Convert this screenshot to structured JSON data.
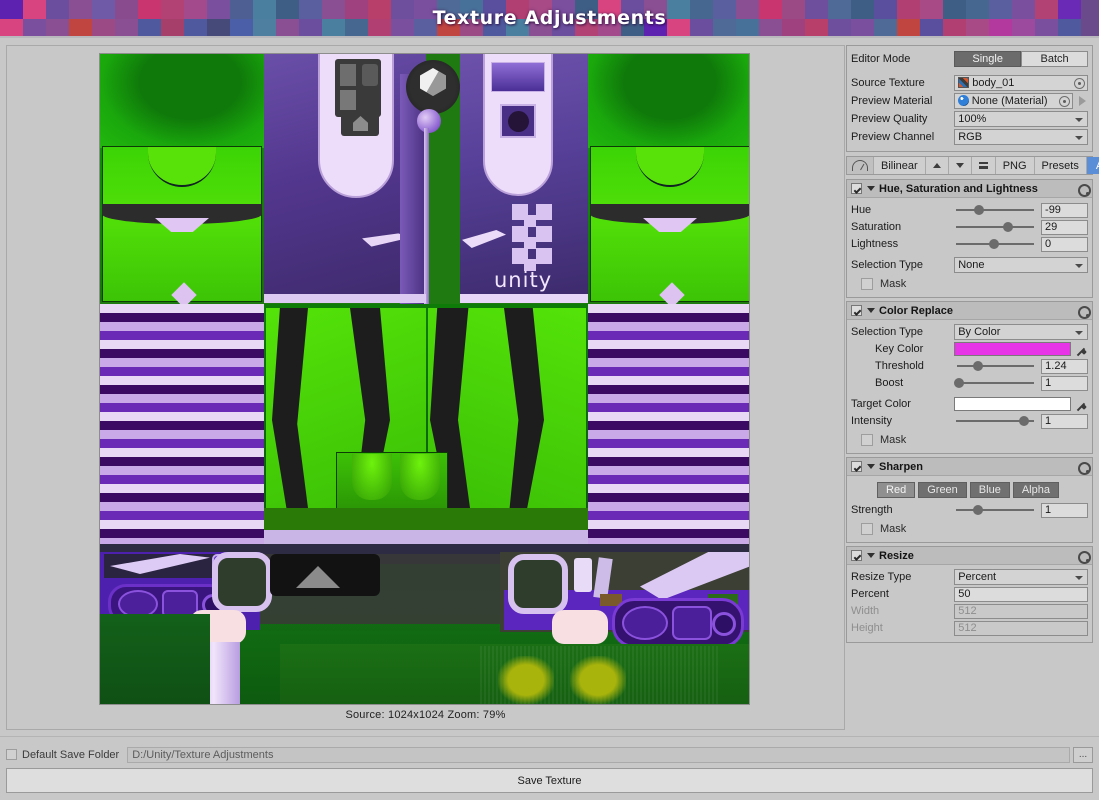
{
  "window": {
    "title": "Texture Adjustments"
  },
  "titlebar_tiles": [
    "#5e22b0",
    "#d8447f",
    "#6b4f9e",
    "#8a4f92",
    "#6f5aa8",
    "#8a4b8e",
    "#c9356f",
    "#b14273",
    "#a24a8c",
    "#7a4f9e",
    "#4e5f94",
    "#4a7fa0",
    "#3f5e86",
    "#5a5fa0",
    "#8a4f92",
    "#a0417f",
    "#b73f6a",
    "#6d4f9e",
    "#7a4f9e",
    "#4f6a96",
    "#48719a",
    "#5a4f9e",
    "#b23f72",
    "#a74a86",
    "#7b4f9e",
    "#3f5e86",
    "#d8447f",
    "#6b4f9e",
    "#8a4f92",
    "#4a7fa0",
    "#46678f",
    "#5a5fa0",
    "#8a4f92",
    "#c9356f",
    "#9b4a86",
    "#6d4f9e",
    "#4f6a96",
    "#3f5e86",
    "#5a4f9e",
    "#b23f72",
    "#a74a86",
    "#3f5e86",
    "#46678f",
    "#5a5fa0",
    "#7a4f9e",
    "#b14273",
    "#6b2ab5",
    "#d8447f",
    "#7a4f9e",
    "#8a4f92",
    "#c0443f",
    "#9b4a86",
    "#8a4f92",
    "#4f5a9e",
    "#a63f6a",
    "#4f5a9e",
    "#454a78",
    "#4a5fa8",
    "#4f7fa0",
    "#8a4f92",
    "#6b4f9e",
    "#4a7fa0",
    "#46678f",
    "#b23f72",
    "#7a4f9e",
    "#5a5fa0",
    "#c0443f",
    "#9b4a86",
    "#4f5a9e",
    "#4a7fa0",
    "#8a4f92",
    "#6b4f9e",
    "#b14273",
    "#a24a8c",
    "#3f5e86",
    "#5e22b0",
    "#d8447f",
    "#6b4f9e",
    "#4f6a96",
    "#48719a",
    "#8a4f92",
    "#a0417f",
    "#b73f6a",
    "#6d4f9e",
    "#7a4f9e",
    "#4f6a96",
    "#c0443f",
    "#5a4f9e",
    "#b23f72",
    "#a74a86",
    "#b4399e",
    "#9b4a9e",
    "#7a4f9e",
    "#4f5a9e",
    "#4a7fa0",
    "#c0443f",
    "#a74a86",
    "#8a4f92",
    "#3f6fa0",
    "#5a5fa0"
  ],
  "preview": {
    "status": "Source: 1024x1024   Zoom: 79%",
    "source_size": "1024x1024",
    "zoom": "79%"
  },
  "inspector": {
    "editor_mode": {
      "label": "Editor Mode",
      "options": [
        "Single",
        "Batch"
      ],
      "selected": "Single"
    },
    "source_texture": {
      "label": "Source Texture",
      "value": "body_01",
      "icon": "texture-icon"
    },
    "preview_material": {
      "label": "Preview Material",
      "value": "None (Material)",
      "icon": "material-icon"
    },
    "preview_quality": {
      "label": "Preview Quality",
      "value": "100%"
    },
    "preview_channel": {
      "label": "Preview Channel",
      "value": "RGB"
    },
    "toolbar": {
      "gauge_icon": "gauge-icon",
      "filter_mode": "Bilinear",
      "move_up_icon": "arrow-up-icon",
      "move_down_icon": "arrow-down-icon",
      "menu_icon": "hamburger-icon",
      "format": "PNG",
      "presets": "Presets",
      "add": "Add"
    },
    "modules": [
      {
        "name": "hsl",
        "title": "Hue, Saturation and Lightness",
        "enabled": true,
        "sliders": [
          {
            "label": "Hue",
            "value": "-99",
            "pos": 28
          },
          {
            "label": "Saturation",
            "value": "29",
            "pos": 62
          },
          {
            "label": "Lightness",
            "value": "0",
            "pos": 45
          }
        ],
        "selection_type": {
          "label": "Selection Type",
          "value": "None"
        },
        "mask": {
          "label": "Mask",
          "checked": false
        }
      },
      {
        "name": "color-replace",
        "title": "Color Replace",
        "enabled": true,
        "selection_type": {
          "label": "Selection Type",
          "value": "By Color"
        },
        "key_color": {
          "label": "Key Color",
          "color": "#e634e6"
        },
        "threshold": {
          "label": "Threshold",
          "value": "1.24",
          "pos": 25
        },
        "boost": {
          "label": "Boost",
          "value": "1",
          "pos": 3
        },
        "target_color": {
          "label": "Target Color",
          "color": "#ffffff"
        },
        "intensity": {
          "label": "Intensity",
          "value": "1",
          "pos": 85
        },
        "mask": {
          "label": "Mask",
          "checked": false
        }
      },
      {
        "name": "sharpen",
        "title": "Sharpen",
        "enabled": true,
        "channels": [
          "Red",
          "Green",
          "Blue",
          "Alpha"
        ],
        "channel_selected": "Red",
        "strength": {
          "label": "Strength",
          "value": "1",
          "pos": 27
        },
        "mask": {
          "label": "Mask",
          "checked": false
        }
      },
      {
        "name": "resize",
        "title": "Resize",
        "enabled": true,
        "resize_type": {
          "label": "Resize Type",
          "value": "Percent"
        },
        "percent": {
          "label": "Percent",
          "value": "50"
        },
        "width": {
          "label": "Width",
          "value": "512",
          "disabled": true
        },
        "height": {
          "label": "Height",
          "value": "512",
          "disabled": true
        }
      }
    ]
  },
  "bottom": {
    "default_save_folder": {
      "label": "Default Save Folder",
      "checked": false
    },
    "save_path": "D:/Unity/Texture Adjustments",
    "browse_label": "...",
    "save_button": "Save Texture"
  }
}
